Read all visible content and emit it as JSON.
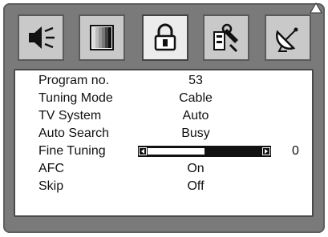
{
  "tabs": [
    {
      "icon": "speaker-icon",
      "active": false
    },
    {
      "icon": "picture-icon",
      "active": false
    },
    {
      "icon": "lock-icon",
      "active": true
    },
    {
      "icon": "tools-icon",
      "active": false
    },
    {
      "icon": "satellite-dish-icon",
      "active": false
    }
  ],
  "menu": {
    "program_no": {
      "label": "Program no.",
      "value": "53"
    },
    "tuning_mode": {
      "label": "Tuning Mode",
      "value": "Cable"
    },
    "tv_system": {
      "label": "TV System",
      "value": "Auto"
    },
    "auto_search": {
      "label": "Auto Search",
      "value": "Busy"
    },
    "fine_tuning": {
      "label": "Fine Tuning",
      "value": "0",
      "slider_fraction": 0.5
    },
    "afc": {
      "label": "AFC",
      "value": "On"
    },
    "skip": {
      "label": "Skip",
      "value": "Off"
    }
  }
}
